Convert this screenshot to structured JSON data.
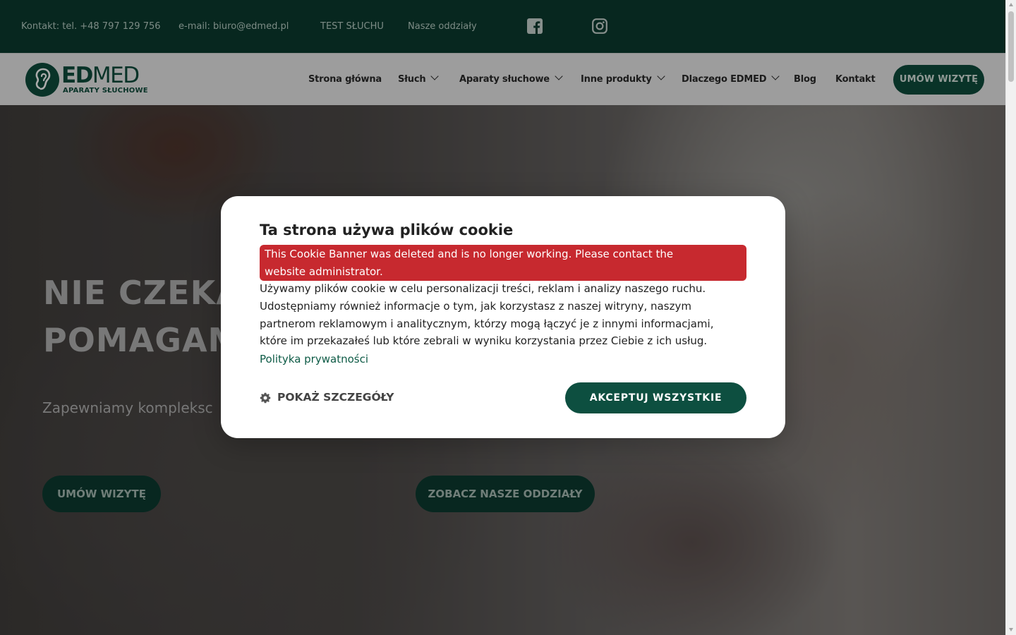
{
  "topbar": {
    "phone": "Kontakt: tel. +48 797 129 756",
    "email": "e-mail: biuro@edmed.pl",
    "hearing_test": "TEST SŁUCHU",
    "branches": "Nasze oddziały",
    "social_icons": [
      "facebook-icon",
      "instagram-icon"
    ]
  },
  "logo": {
    "name_bold": "ED",
    "name_light": "MED",
    "tagline": "APARATY SŁUCHOWE"
  },
  "nav": {
    "items": [
      {
        "label": "Strona główna",
        "dropdown": false
      },
      {
        "label": "Słuch",
        "dropdown": true
      },
      {
        "label": "Aparaty słuchowe",
        "dropdown": true
      },
      {
        "label": "Inne produkty",
        "dropdown": true
      },
      {
        "label": "Dlaczego EDMED",
        "dropdown": true
      },
      {
        "label": "Blog",
        "dropdown": false
      },
      {
        "label": "Kontakt",
        "dropdown": false
      }
    ],
    "cta": "UMÓW WIZYTĘ"
  },
  "hero": {
    "headline_line1": "NIE CZEKA",
    "headline_line2": "POMAGAM",
    "subheadline": "Zapewniamy kompleksc",
    "button_primary": "UMÓW WIZYTĘ",
    "button_secondary": "ZOBACZ NASZE ODDZIAŁY"
  },
  "cookie_modal": {
    "title": "Ta strona używa plików cookie",
    "error_line1": "This Cookie Banner was deleted and is no longer working. Please contact the",
    "error_line2": "website administrator.",
    "body_line1": "Używamy plików cookie w celu personalizacji treści, reklam i analizy naszego ruchu.",
    "body_line2": "Udostępniamy również informacje o tym, jak korzystasz z naszej witryny, naszym",
    "body_line3": "partnerom reklamowym i analitycznym, którzy mogą łączyć je z innymi informacjami,",
    "body_line4": "które im przekazałeś lub które zebrali w wyniku korzystania przez Ciebie z ich usług.",
    "privacy_link": "Polityka prywatności",
    "show_details": "POKAŻ SZCZEGÓŁY",
    "accept_all": "AKCEPTUJ WSZYSTKIE"
  },
  "colors": {
    "brand_dark_green": "#0b3b2f",
    "brand_green": "#0e4d3d",
    "error_red": "#c7292f",
    "link_green": "#0e5b46"
  }
}
